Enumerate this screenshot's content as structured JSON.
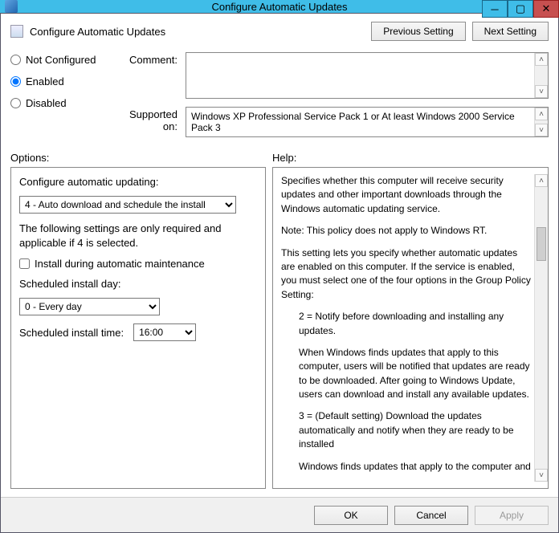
{
  "window": {
    "title": "Configure Automatic Updates"
  },
  "header": {
    "policy_name": "Configure Automatic Updates",
    "prev_button": "Previous Setting",
    "next_button": "Next Setting"
  },
  "radios": {
    "not_configured": "Not Configured",
    "enabled": "Enabled",
    "disabled": "Disabled",
    "selected": "enabled"
  },
  "labels": {
    "comment": "Comment:",
    "supported_on": "Supported on:",
    "options": "Options:",
    "help": "Help:"
  },
  "comment_value": "",
  "supported_on_text": "Windows XP Professional Service Pack 1 or At least Windows 2000 Service Pack 3",
  "options": {
    "configure_label": "Configure automatic updating:",
    "configure_value": "4 - Auto download and schedule the install",
    "note": "The following settings are only required and applicable if 4 is selected.",
    "install_maintenance": "Install during automatic maintenance",
    "install_maintenance_checked": false,
    "day_label": "Scheduled install day:",
    "day_value": "0 - Every day",
    "time_label": "Scheduled install time:",
    "time_value": "16:00"
  },
  "help": {
    "p1": "Specifies whether this computer will receive security updates and other important downloads through the Windows automatic updating service.",
    "p2": "Note: This policy does not apply to Windows RT.",
    "p3": "This setting lets you specify whether automatic updates are enabled on this computer. If the service is enabled, you must select one of the four options in the Group Policy Setting:",
    "p4": "2 = Notify before downloading and installing any updates.",
    "p5": "When Windows finds updates that apply to this computer, users will be notified that updates are ready to be downloaded. After going to Windows Update, users can download and install any available updates.",
    "p6": "3 = (Default setting) Download the updates automatically and notify when they are ready to be installed",
    "p7": "Windows finds updates that apply to the computer and"
  },
  "buttons": {
    "ok": "OK",
    "cancel": "Cancel",
    "apply": "Apply"
  }
}
